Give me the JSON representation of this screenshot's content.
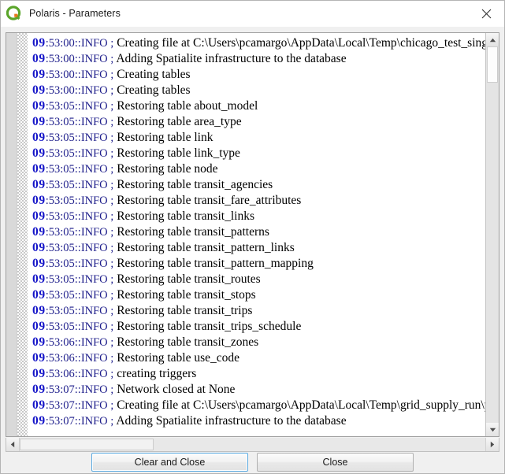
{
  "window": {
    "title": "Polaris - Parameters",
    "app_icon": "qgis-logo-icon",
    "close_icon": "close-icon"
  },
  "log": {
    "lines": [
      {
        "hour": "09",
        "rest": ":53:00::INFO ;",
        "message": "Creating file at C:\\Users\\pcamargo\\AppData\\Local\\Temp\\chicago_test_single"
      },
      {
        "hour": "09",
        "rest": ":53:00::INFO ;",
        "message": "Adding Spatialite infrastructure to the database"
      },
      {
        "hour": "09",
        "rest": ":53:00::INFO ;",
        "message": "Creating tables"
      },
      {
        "hour": "09",
        "rest": ":53:00::INFO ;",
        "message": "Creating tables"
      },
      {
        "hour": "09",
        "rest": ":53:05::INFO ;",
        "message": "Restoring table about_model"
      },
      {
        "hour": "09",
        "rest": ":53:05::INFO ;",
        "message": "Restoring table area_type"
      },
      {
        "hour": "09",
        "rest": ":53:05::INFO ;",
        "message": "Restoring table link"
      },
      {
        "hour": "09",
        "rest": ":53:05::INFO ;",
        "message": "Restoring table link_type"
      },
      {
        "hour": "09",
        "rest": ":53:05::INFO ;",
        "message": "Restoring table node"
      },
      {
        "hour": "09",
        "rest": ":53:05::INFO ;",
        "message": "Restoring table transit_agencies"
      },
      {
        "hour": "09",
        "rest": ":53:05::INFO ;",
        "message": "Restoring table transit_fare_attributes"
      },
      {
        "hour": "09",
        "rest": ":53:05::INFO ;",
        "message": "Restoring table transit_links"
      },
      {
        "hour": "09",
        "rest": ":53:05::INFO ;",
        "message": "Restoring table transit_patterns"
      },
      {
        "hour": "09",
        "rest": ":53:05::INFO ;",
        "message": "Restoring table transit_pattern_links"
      },
      {
        "hour": "09",
        "rest": ":53:05::INFO ;",
        "message": "Restoring table transit_pattern_mapping"
      },
      {
        "hour": "09",
        "rest": ":53:05::INFO ;",
        "message": "Restoring table transit_routes"
      },
      {
        "hour": "09",
        "rest": ":53:05::INFO ;",
        "message": "Restoring table transit_stops"
      },
      {
        "hour": "09",
        "rest": ":53:05::INFO ;",
        "message": "Restoring table transit_trips"
      },
      {
        "hour": "09",
        "rest": ":53:05::INFO ;",
        "message": "Restoring table transit_trips_schedule"
      },
      {
        "hour": "09",
        "rest": ":53:06::INFO ;",
        "message": "Restoring table transit_zones"
      },
      {
        "hour": "09",
        "rest": ":53:06::INFO ;",
        "message": "Restoring table use_code"
      },
      {
        "hour": "09",
        "rest": ":53:06::INFO ;",
        "message": "creating triggers"
      },
      {
        "hour": "09",
        "rest": ":53:07::INFO ;",
        "message": "Network closed at None"
      },
      {
        "hour": "09",
        "rest": ":53:07::INFO ;",
        "message": "Creating file at C:\\Users\\pcamargo\\AppData\\Local\\Temp\\grid_supply_run\\pol"
      },
      {
        "hour": "09",
        "rest": ":53:07::INFO ;",
        "message": "Adding Spatialite infrastructure to the database"
      }
    ]
  },
  "scrollbars": {
    "vertical": {
      "up_icon": "scroll-up-arrow-icon",
      "down_icon": "scroll-down-arrow-icon"
    },
    "horizontal": {
      "left_icon": "scroll-left-arrow-icon",
      "right_icon": "scroll-right-arrow-icon"
    }
  },
  "buttons": {
    "clear_and_close": "Clear and Close",
    "close": "Close"
  }
}
